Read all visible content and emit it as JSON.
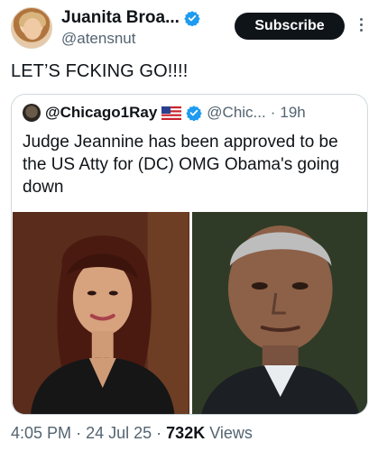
{
  "author": {
    "display_name": "Juanita Broa...",
    "handle": "@atensnut"
  },
  "actions": {
    "subscribe_label": "Subscribe"
  },
  "tweet": {
    "text": "LET’S FCKING GO!!!!"
  },
  "quote": {
    "author_name": "@Chicago1Ray",
    "handle": "@Chic...",
    "separator": "·",
    "time": "19h",
    "text": "Judge Jeannine has been approved to be the US Atty for (DC) OMG Obama's going down"
  },
  "meta": {
    "time": "4:05 PM",
    "sep1": "·",
    "date": "24 Jul 25",
    "sep2": "·",
    "views_count": "732K",
    "views_label": "Views"
  },
  "colors": {
    "verified": "#1d9bf0",
    "text_primary": "#0f1419",
    "text_secondary": "#536471",
    "card_border": "#cfd9de"
  },
  "icons": {
    "verified": "verified-badge-icon",
    "flag": "us-flag-icon",
    "more": "more-vertical-icon"
  }
}
